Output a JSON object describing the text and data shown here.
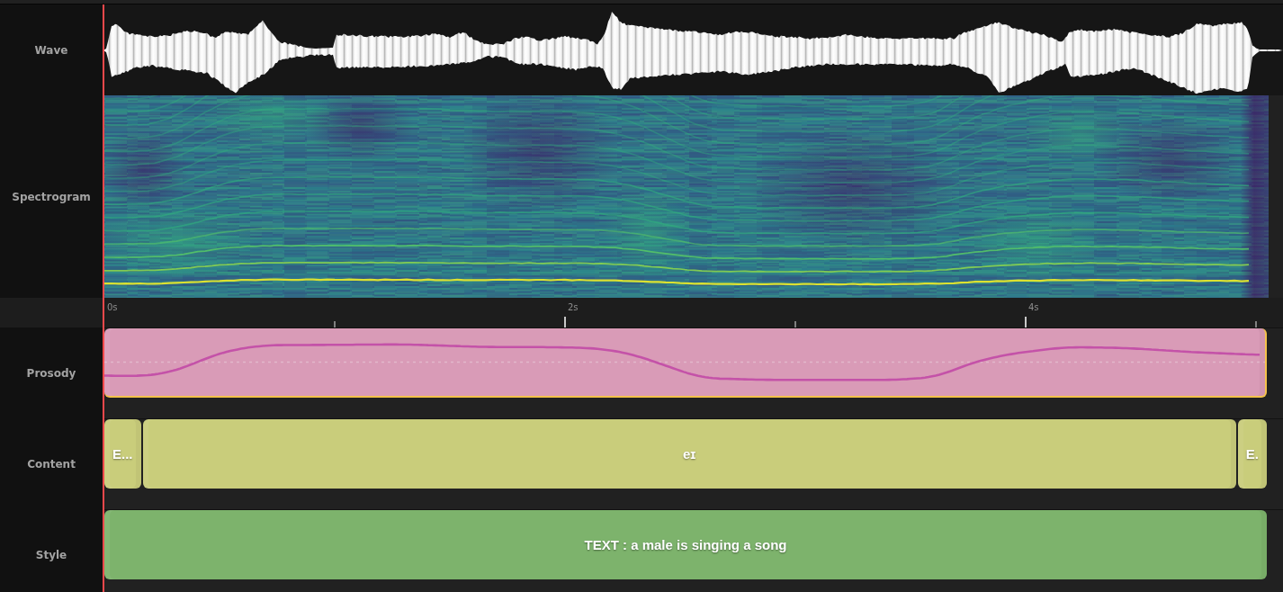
{
  "tracks": [
    {
      "kind": "wave",
      "label": "Wave"
    },
    {
      "kind": "spectrogram",
      "label": "Spectrogram"
    }
  ],
  "ruler": {
    "ticks": [
      "0s",
      "2s",
      "4s"
    ]
  },
  "lanes": [
    {
      "kind": "prosody",
      "label": "Prosody",
      "color": "#d99bb7",
      "clips": [
        {
          "selected": true
        }
      ]
    },
    {
      "kind": "content",
      "label": "Content",
      "color": "#c9cd7b",
      "clips": [
        {
          "text": "E...",
          "selected": false
        },
        {
          "text": "eɪ",
          "selected": false
        },
        {
          "text": "E.",
          "selected": false
        }
      ]
    },
    {
      "kind": "style",
      "label": "Style",
      "color": "#7db36c",
      "clips": [
        {
          "text": "TEXT : a male is singing a song",
          "selected": false
        }
      ]
    }
  ]
}
